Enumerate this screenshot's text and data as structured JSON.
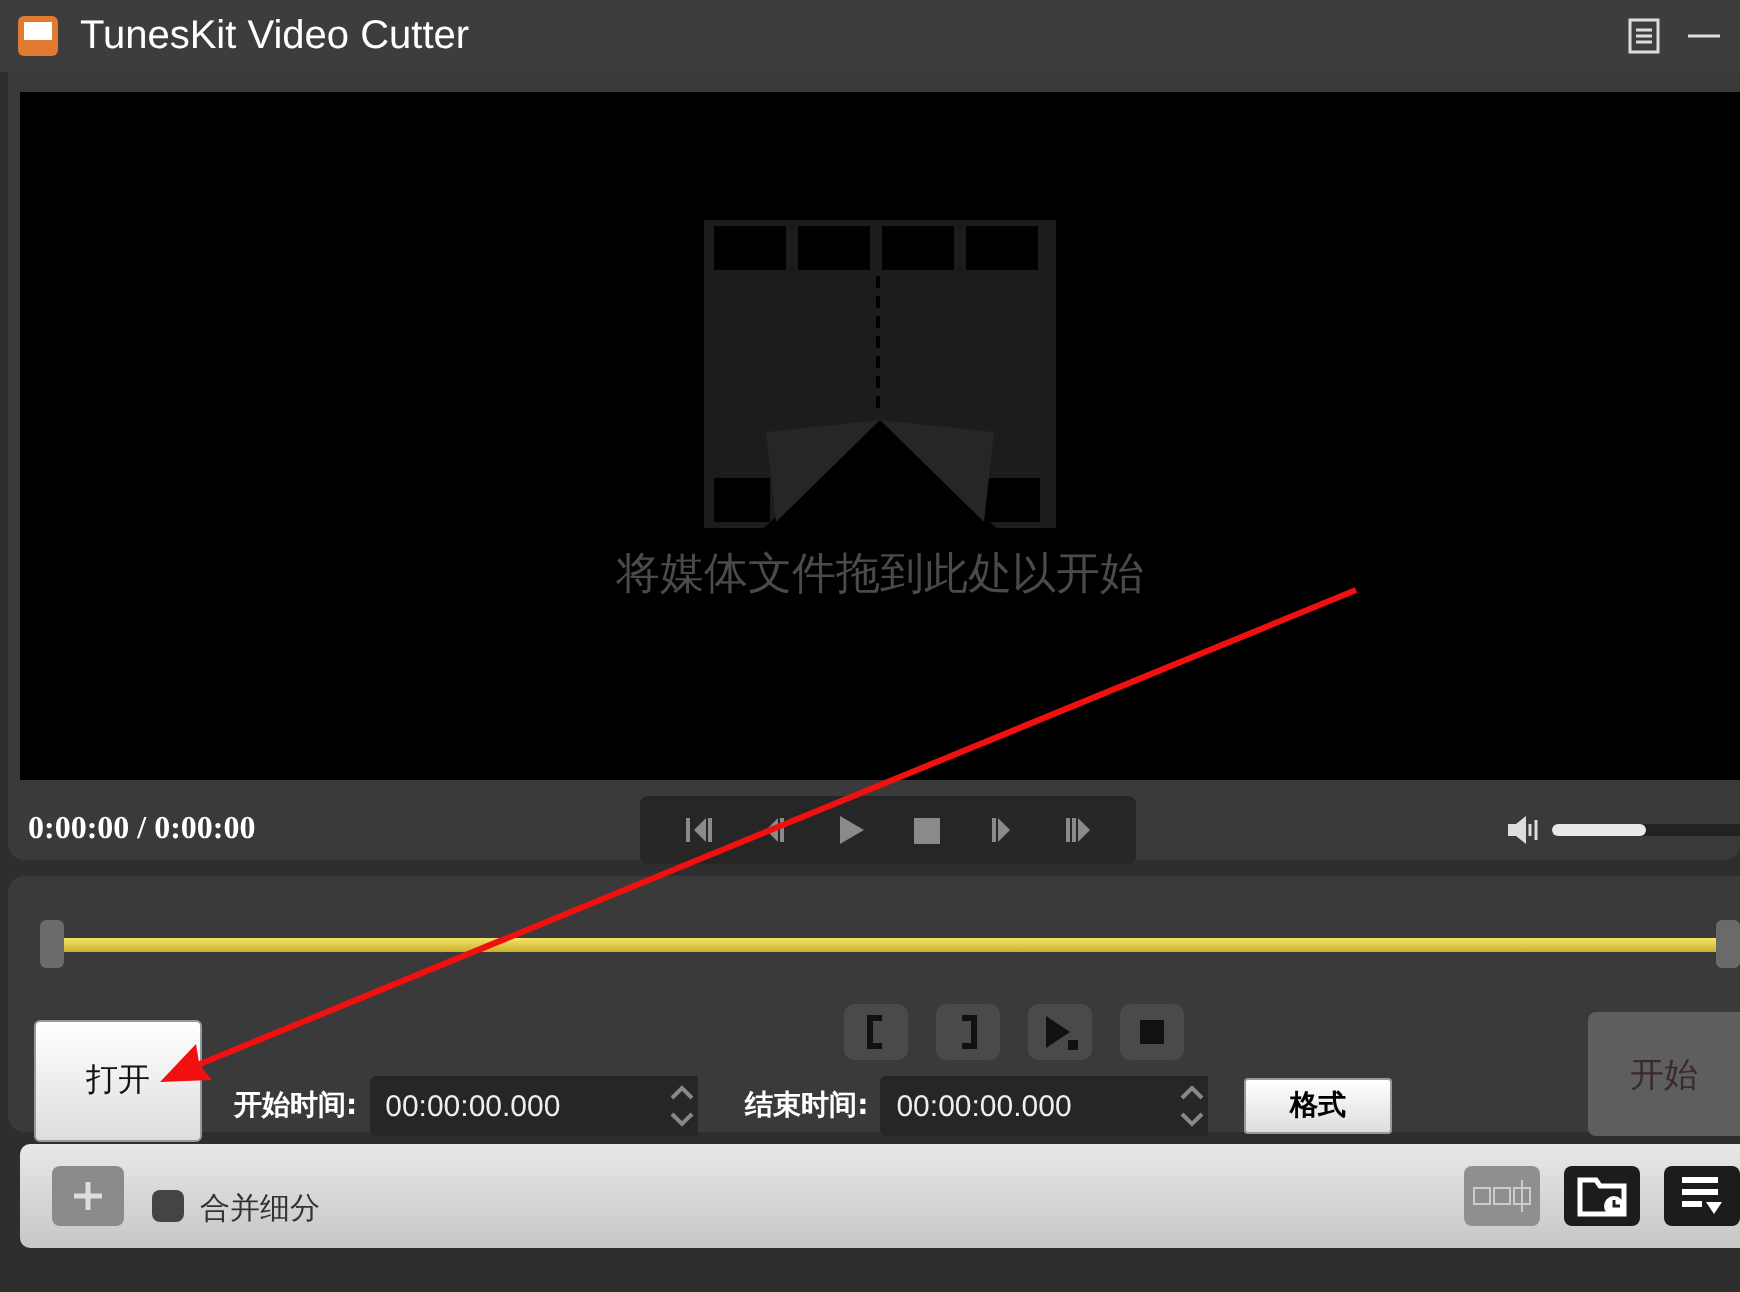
{
  "window": {
    "title": "TunesKit Video Cutter"
  },
  "player": {
    "drop_hint": "将媒体文件拖到此处以开始",
    "time": "0:00:00 / 0:00:00",
    "volume": {
      "level": 0.5
    }
  },
  "trim": {
    "open_button": "打开",
    "start_label": "开始时间:",
    "start_time": "00:00:00.000",
    "end_label": "结束时间:",
    "end_time": "00:00:00.000",
    "format_button": "格式",
    "start_button": {
      "label": "开始",
      "disabled": true
    }
  },
  "toolbar": {
    "add_button": {
      "disabled": true
    },
    "merge": {
      "label": "合并细分",
      "checked": false
    },
    "segments_button": {
      "disabled": true
    }
  }
}
